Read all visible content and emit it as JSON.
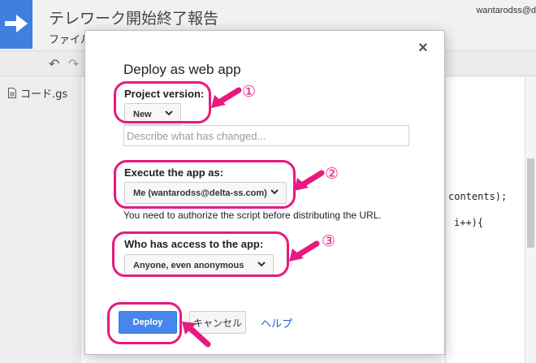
{
  "app": {
    "title": "テレワーク開始終了報告",
    "menu_label": "ファイル",
    "user": "wantarodss@d",
    "undo_glyph": "↶",
    "redo_glyph": "↷",
    "file_name": "コード.gs",
    "code_line_1": "contents);",
    "code_line_2": "i++){"
  },
  "dialog": {
    "title": "Deploy as web app",
    "close_glyph": "×",
    "project_version": {
      "label": "Project version:",
      "value": "New",
      "description_placeholder": "Describe what has changed..."
    },
    "execute_as": {
      "label": "Execute the app as:",
      "value": "Me (wantarodss@delta-ss.com)",
      "note": "You need to authorize the script before distributing the URL."
    },
    "access": {
      "label": "Who has access to the app:",
      "value": "Anyone, even anonymous"
    },
    "buttons": {
      "deploy": "Deploy",
      "cancel": "キャンセル",
      "help": "ヘルプ"
    }
  },
  "annotations": {
    "callout_1": "①",
    "callout_2": "②",
    "callout_3": "③",
    "highlight_color": "#e8197f"
  },
  "colors": {
    "accent": "#4787ed",
    "link": "#1c5fd6",
    "logo": "#3f7fde"
  }
}
